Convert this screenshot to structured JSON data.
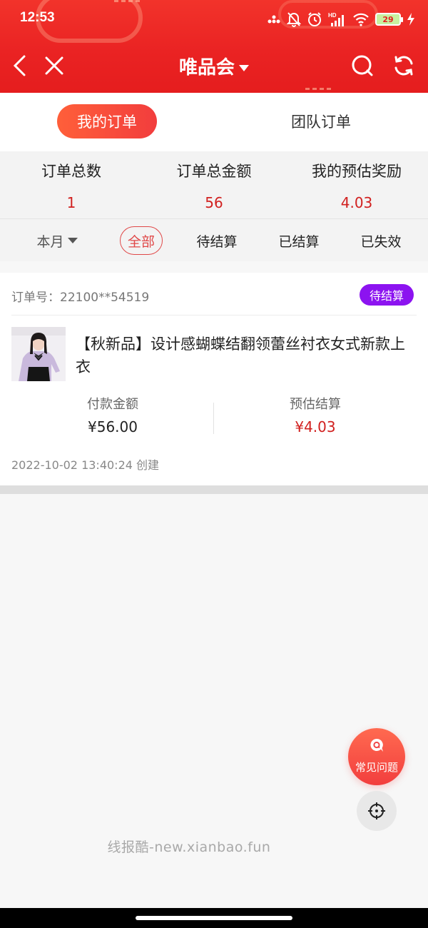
{
  "status_bar": {
    "time": "12:53",
    "battery": "29",
    "icons": [
      "signal-dots-icon",
      "bell-off-icon",
      "alarm-icon",
      "hd-signal-icon",
      "wifi-icon",
      "battery-icon",
      "charging-icon"
    ]
  },
  "nav": {
    "title": "唯品会",
    "back_icon": "chevron-left-icon",
    "close_icon": "close-icon",
    "search_icon": "search-icon",
    "refresh_icon": "refresh-icon"
  },
  "tabs": {
    "mine": "我的订单",
    "team": "团队订单"
  },
  "stats": {
    "total_orders_label": "订单总数",
    "total_orders_value": "1",
    "total_amount_label": "订单总金额",
    "total_amount_value": "56",
    "reward_label": "我的预估奖励",
    "reward_value": "4.03"
  },
  "filters": {
    "month": "本月",
    "all": "全部",
    "pending": "待结算",
    "settled": "已结算",
    "invalid": "已失效",
    "selected": "全部"
  },
  "order": {
    "order_no": "订单号：22100**54519",
    "status": "待结算",
    "title": "【秋新品】设计感蝴蝶结翻领蕾丝衬衣女式新款上衣",
    "pay_label": "付款金额",
    "pay_value": "¥56.00",
    "est_label": "预估结算",
    "est_value": "¥4.03",
    "created": "2022-10-02 13:40:24  创建"
  },
  "floating": {
    "faq_label": "常见问题",
    "faq_icon": "chat-q-icon",
    "locate_icon": "crosshair-icon"
  },
  "watermark": "线报酷-new.xianbao.fun",
  "colors": {
    "brand_red": "#ea2323",
    "value_red": "#d1201f",
    "badge_purple": "#8c13f0"
  }
}
